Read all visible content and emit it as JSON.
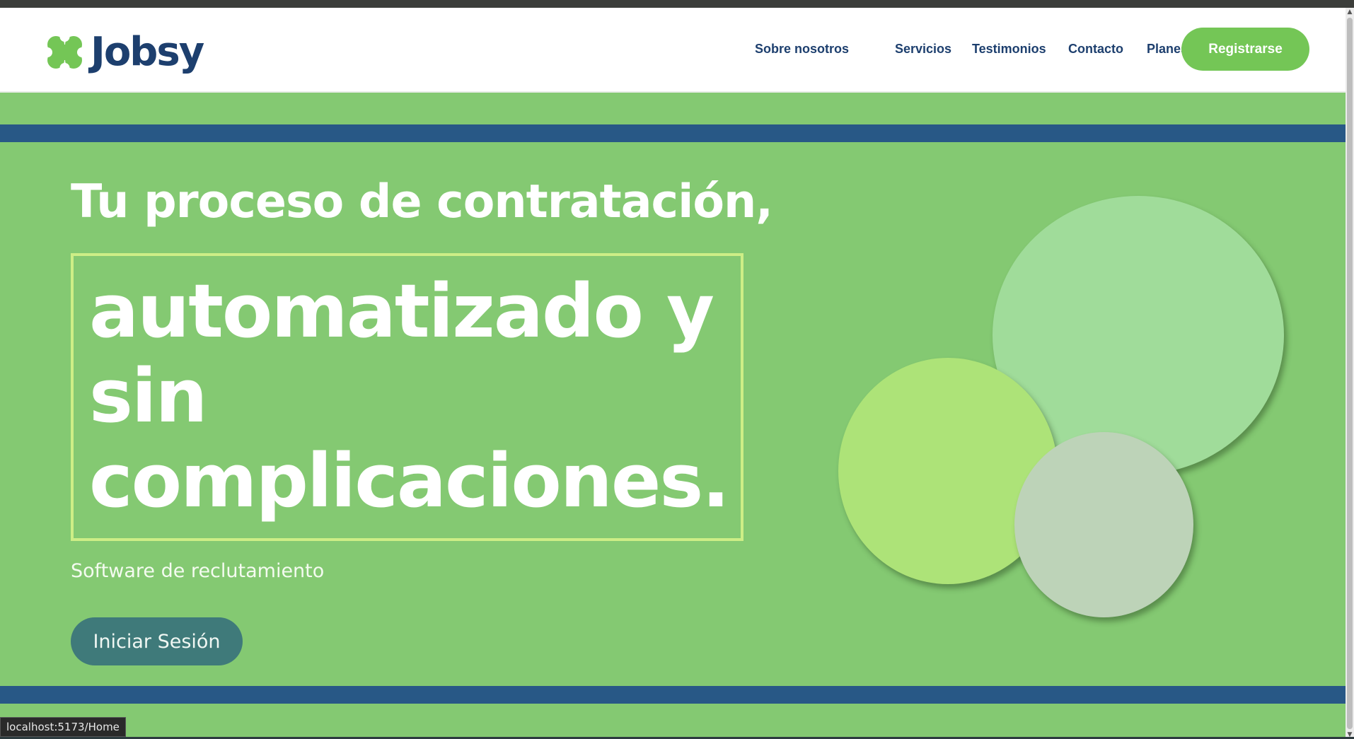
{
  "colors": {
    "page_bg": "#84c972",
    "navy": "#1d3f6e",
    "accent_green": "#74c656",
    "blue_band": "#285886",
    "box_border": "#cdee86",
    "login_bg": "#3f7a7a",
    "circle_big": "#a0dc9a",
    "circle_left": "#ade378",
    "circle_small": "#bdd3b8"
  },
  "brand": {
    "name": "Jobsy",
    "icon": "logo-cluster-icon"
  },
  "nav": {
    "links": [
      "Sobre nosotros",
      "Servicios",
      "Testimonios",
      "Contacto",
      "Planes"
    ],
    "register_label": "Registrarse"
  },
  "hero": {
    "line1": "Tu proceso de contratación,",
    "highlight": "automatizado y sin complicaciones.",
    "subtitle": "Software de reclutamiento",
    "login_label": "Iniciar Sesión"
  },
  "status_bar": {
    "url": "localhost:5173/Home"
  }
}
